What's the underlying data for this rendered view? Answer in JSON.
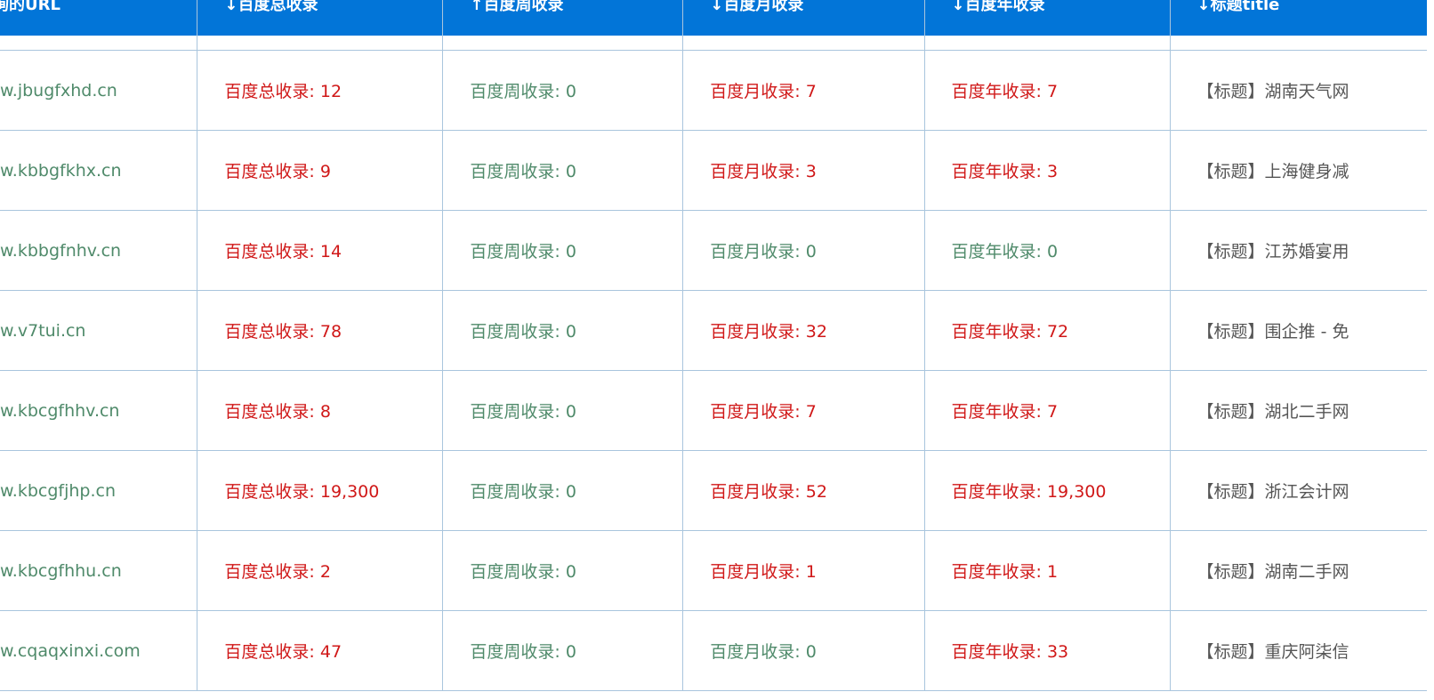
{
  "colors": {
    "header_bg": "#0275d8",
    "header_text": "#ffffff",
    "grid_line": "#a9c5dd",
    "nonzero_value": "#d01818",
    "zero_value": "#4f8a6a",
    "url_text": "#4f8a6a",
    "title_text": "#555555"
  },
  "table": {
    "headers": {
      "url": "询的URL",
      "total": "↓百度总收录",
      "week": "↑百度周收录",
      "month": "↓百度月收录",
      "year": "↓百度年收录",
      "title": "↓标题title"
    },
    "rows": [
      {
        "url": "w.jbugfxhd.cn",
        "total": "百度总收录: 12",
        "week": "百度周收录: 0",
        "month": "百度月收录: 7",
        "year": "百度年收录: 7",
        "title": "【标题】湖南天气网"
      },
      {
        "url": "w.kbbgfkhx.cn",
        "total": "百度总收录: 9",
        "week": "百度周收录: 0",
        "month": "百度月收录: 3",
        "year": "百度年收录: 3",
        "title": "【标题】上海健身减"
      },
      {
        "url": "w.kbbgfnhv.cn",
        "total": "百度总收录: 14",
        "week": "百度周收录: 0",
        "month": "百度月收录: 0",
        "year": "百度年收录: 0",
        "title": "【标题】江苏婚宴用"
      },
      {
        "url": "w.v7tui.cn",
        "total": "百度总收录: 78",
        "week": "百度周收录: 0",
        "month": "百度月收录: 32",
        "year": "百度年收录: 72",
        "title": "【标题】围企推 - 免"
      },
      {
        "url": "w.kbcgfhhv.cn",
        "total": "百度总收录: 8",
        "week": "百度周收录: 0",
        "month": "百度月收录: 7",
        "year": "百度年收录: 7",
        "title": "【标题】湖北二手网"
      },
      {
        "url": "w.kbcgfjhp.cn",
        "total": "百度总收录: 19,300",
        "week": "百度周收录: 0",
        "month": "百度月收录: 52",
        "year": "百度年收录: 19,300",
        "title": "【标题】浙江会计网"
      },
      {
        "url": "w.kbcgfhhu.cn",
        "total": "百度总收录: 2",
        "week": "百度周收录: 0",
        "month": "百度月收录: 1",
        "year": "百度年收录: 1",
        "title": "【标题】湖南二手网"
      },
      {
        "url": "w.cqaqxinxi.com",
        "total": "百度总收录: 47",
        "week": "百度周收录: 0",
        "month": "百度月收录: 0",
        "year": "百度年收录: 33",
        "title": "【标题】重庆阿柒信"
      }
    ]
  }
}
